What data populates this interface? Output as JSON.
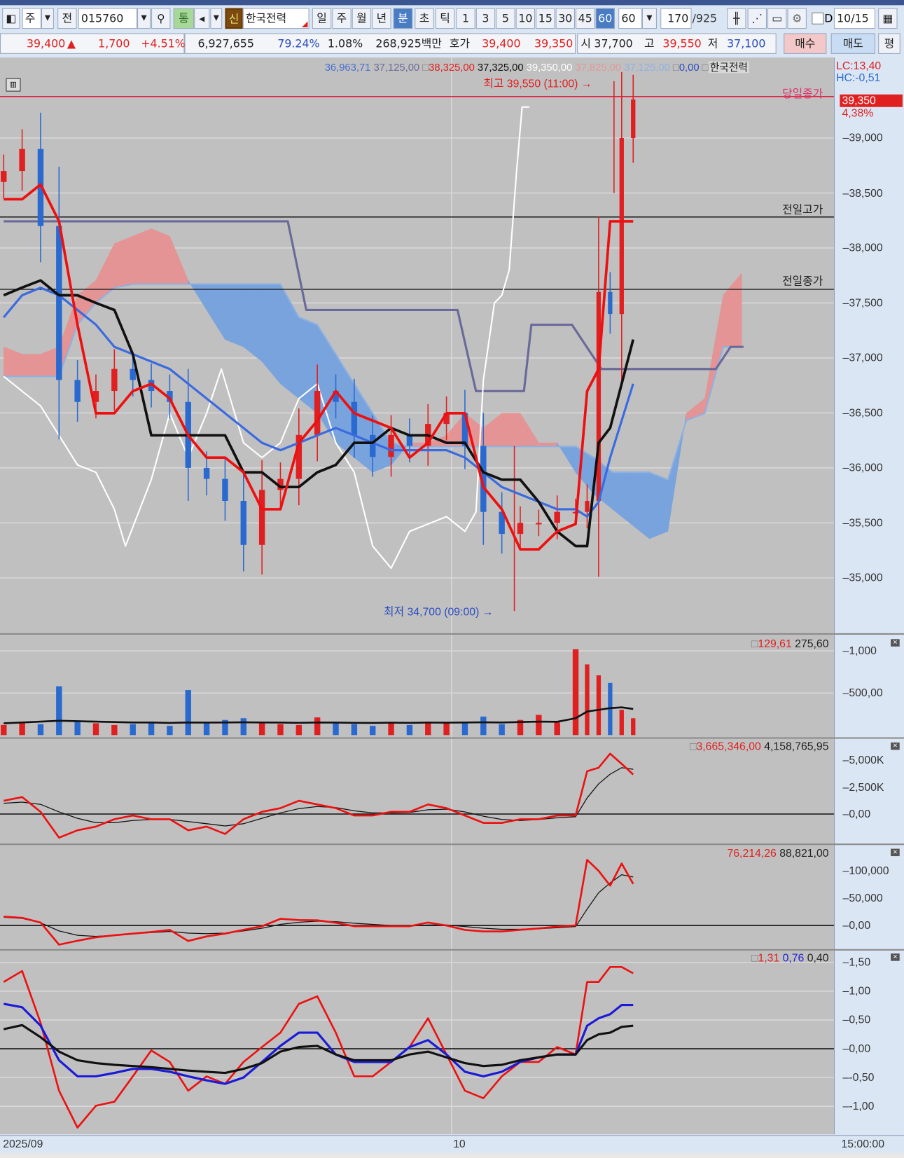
{
  "toolbar": {
    "period_type": "주",
    "prev_label": "전",
    "code": "015760",
    "tong": "통",
    "shin": "신",
    "name": "한국전력",
    "periods": [
      "일",
      "주",
      "월",
      "년",
      "분",
      "초",
      "틱"
    ],
    "minutes": [
      "1",
      "3",
      "5",
      "10",
      "15",
      "30",
      "45",
      "60"
    ],
    "minute_select": "60",
    "count": "170",
    "count_total": "/925",
    "d_label": "D",
    "date": "10/15"
  },
  "quote": {
    "price": "39,400",
    "arrow": "▲",
    "change": "1,700",
    "change_pct": "+4.51%",
    "volume": "6,927,655",
    "ratio": "79.24%",
    "turnover": "1.08%",
    "amount": "268,925백만",
    "bid_label": "호가",
    "ask": "39,400",
    "bid": "39,350",
    "open_label": "시",
    "open": "37,700",
    "high_label": "고",
    "high": "39,550",
    "low_label": "저",
    "low": "37,100",
    "buy": "매수",
    "sell": "매도",
    "avg": "평"
  },
  "main_legend": [
    "36,963,71",
    "37,125,00",
    "38,325,00",
    "37,325,00",
    "39,350,00",
    "37,825,00",
    "37,125,00",
    "0,00",
    "한국전력"
  ],
  "annotations": {
    "high": "최고 39,550 (11:00) →",
    "low": "최저 34,700 (09:00) →",
    "today_close": "당일종가",
    "prev_high": "전일고가",
    "prev_close": "전일종가",
    "lc": "LC:13,40",
    "hc": "HC:-0,51",
    "price_tag": "39,350",
    "pct_tag": "4,38%"
  },
  "colors": {
    "up": "#e02020",
    "down": "#2a6ad0",
    "cloud_up": "#e49494",
    "cloud_down": "#79a3dc",
    "ma": "#3a6ae0",
    "base": "#6a6a9a"
  },
  "chart_data": {
    "type": "candlestick",
    "title": "한국전력 60분",
    "price_axis": {
      "ticks": [
        "39,000",
        "38,500",
        "38,000",
        "37,500",
        "37,000",
        "36,500",
        "36,000",
        "35,500",
        "35,000"
      ],
      "tick_values": [
        39000,
        38500,
        38000,
        37500,
        37000,
        36500,
        36000,
        35500,
        35000
      ]
    },
    "x_labels": [
      "2025/09",
      "10",
      "15:00:00"
    ],
    "first_open": 38600,
    "closes": [
      38700,
      38900,
      38200,
      36800,
      36600,
      36700,
      36900,
      36800,
      36700,
      36600,
      36000,
      35900,
      35700,
      35300,
      35800,
      35900,
      36300,
      36700,
      36600,
      36300,
      36100,
      36300,
      36200,
      36400,
      36500,
      36200,
      35600,
      35400,
      35500,
      35500,
      35600,
      35600,
      35700,
      37600,
      37400,
      39000,
      39350
    ],
    "lines": {
      "conversion": [
        38443,
        38443,
        38577,
        38242,
        37302,
        36497,
        36497,
        36698,
        36765,
        36631,
        36296,
        36094,
        36094,
        35960,
        35624,
        35624,
        36228,
        36430,
        36698,
        36497,
        36430,
        36363,
        36094,
        36228,
        36497,
        36497,
        35826,
        35624,
        35260,
        35260,
        35423,
        35490,
        36698,
        36899,
        38242,
        38242,
        38242
      ],
      "base": [
        37570,
        37640,
        37705,
        37570,
        37570,
        37500,
        37436,
        37034,
        36296,
        36296,
        36296,
        36296,
        36296,
        35960,
        35960,
        35826,
        35826,
        35960,
        36027,
        36228,
        36228,
        36363,
        36296,
        36296,
        36228,
        36228,
        35960,
        35893,
        35893,
        35691,
        35423,
        35289,
        35289,
        36228,
        36363,
        36765,
        37168
      ],
      "ma": [
        37369,
        37570,
        37638,
        37570,
        37436,
        37302,
        37101,
        37034,
        36967,
        36899,
        36765,
        36631,
        36497,
        36363,
        36228,
        36161,
        36228,
        36296,
        36363,
        36296,
        36228,
        36161,
        36161,
        36161,
        36161,
        36094,
        35960,
        35826,
        35759,
        35691,
        35624,
        35624,
        35557,
        35691,
        36094,
        36430,
        36765
      ],
      "lagging": [
        [
          0,
          36832
        ],
        [
          2,
          36564
        ],
        [
          4,
          36027
        ],
        [
          5,
          35960
        ],
        [
          6,
          35624
        ],
        [
          6.6,
          35289
        ],
        [
          8,
          35893
        ],
        [
          9,
          36497
        ],
        [
          10,
          36094
        ],
        [
          11,
          36497
        ],
        [
          11.8,
          36899
        ],
        [
          13,
          36228
        ],
        [
          14,
          36094
        ],
        [
          15,
          36228
        ],
        [
          16,
          36631
        ],
        [
          17,
          36765
        ],
        [
          18,
          36228
        ],
        [
          19,
          35960
        ],
        [
          20,
          35289
        ],
        [
          21,
          35088
        ],
        [
          22,
          35423
        ],
        [
          23,
          35490
        ],
        [
          24,
          35557
        ],
        [
          25,
          35423
        ],
        [
          25.6,
          35600
        ],
        [
          26,
          36800
        ],
        [
          26.6,
          37500
        ],
        [
          27,
          37570
        ],
        [
          27.4,
          37800
        ],
        [
          27.8,
          38700
        ],
        [
          28.1,
          39282
        ],
        [
          28.5,
          39282
        ]
      ],
      "long_base": [
        [
          0,
          38242
        ],
        [
          15.4,
          38242
        ],
        [
          16.4,
          37436
        ],
        [
          24.6,
          37436
        ],
        [
          25.6,
          36698
        ],
        [
          28.2,
          36698
        ],
        [
          28.6,
          37302
        ],
        [
          30.8,
          37302
        ],
        [
          32.4,
          36899
        ],
        [
          38.6,
          36899
        ],
        [
          39.4,
          37101
        ],
        [
          40.1,
          37101
        ]
      ],
      "span_a": [
        37101,
        37034,
        37034,
        37101,
        37570,
        37705,
        38040,
        38107,
        38175,
        38107,
        37705,
        37436,
        37168,
        37101,
        36967,
        36765,
        36631,
        36497,
        36228,
        36094,
        35960,
        36027,
        36228,
        36228,
        36296,
        36497,
        36363,
        36497,
        36497,
        36228,
        36228,
        35960,
        35759,
        35624,
        35490,
        35356,
        35423,
        36497,
        36631,
        37570,
        37772
      ],
      "span_b": [
        36832,
        36832,
        36832,
        36832,
        37302,
        37503,
        37638,
        37671,
        37671,
        37671,
        37671,
        37671,
        37671,
        37671,
        37671,
        37671,
        37369,
        37302,
        37034,
        36765,
        36497,
        36228,
        36195,
        36195,
        36195,
        36195,
        36195,
        36195,
        36195,
        36195,
        36195,
        36195,
        36094,
        35960,
        35960,
        35960,
        35893,
        36430,
        36497,
        37101,
        37101
      ]
    },
    "volume": {
      "legend": [
        "129,61",
        "275,60"
      ],
      "ticks": [
        "1,000",
        "500,00"
      ],
      "values": [
        120,
        150,
        130,
        580,
        160,
        140,
        120,
        130,
        150,
        110,
        535,
        140,
        180,
        200,
        150,
        130,
        120,
        210,
        150,
        130,
        110,
        140,
        120,
        160,
        140,
        150,
        220,
        130,
        180,
        240,
        150,
        1020,
        840,
        710,
        620,
        300,
        200
      ],
      "ma": [
        140,
        150,
        160,
        170,
        165,
        160,
        155,
        150,
        150,
        145,
        150,
        148,
        150,
        152,
        150,
        148,
        146,
        150,
        148,
        146,
        145,
        147,
        146,
        148,
        147,
        150,
        152,
        150,
        155,
        160,
        158,
        200,
        280,
        300,
        320,
        330,
        310
      ]
    },
    "obv": {
      "legend": [
        "3,665,346,00",
        "4,158,765,95"
      ],
      "ticks": [
        "5,000K",
        "2,500K",
        "0,00"
      ],
      "unit": "K",
      "red": [
        1233,
        1576,
        206,
        -2192,
        -1507,
        -1165,
        -480,
        -137,
        -480,
        -480,
        -1507,
        -1165,
        -1850,
        -480,
        206,
        548,
        1233,
        891,
        548,
        -137,
        -137,
        206,
        206,
        891,
        548,
        -137,
        -822,
        -822,
        -480,
        -480,
        -137,
        -137,
        3973,
        4300,
        5600,
        4658,
        3665
      ],
      "black": [
        1000,
        1100,
        900,
        200,
        -400,
        -800,
        -800,
        -600,
        -500,
        -500,
        -700,
        -900,
        -1100,
        -900,
        -400,
        100,
        500,
        700,
        600,
        300,
        100,
        100,
        150,
        400,
        450,
        200,
        -200,
        -500,
        -600,
        -500,
        -350,
        -250,
        1500,
        2800,
        3700,
        4300,
        4159
      ]
    },
    "ind2": {
      "legend": [
        "76,214,26",
        "88,821,00"
      ],
      "ticks": [
        "100,000",
        "50,000",
        "0,00"
      ],
      "red": [
        16200,
        14000,
        5400,
        -35100,
        -28000,
        -21600,
        -18000,
        -14900,
        -12000,
        -8100,
        -28400,
        -20000,
        -14900,
        -8000,
        -1400,
        12200,
        10000,
        9500,
        5000,
        -1400,
        -1400,
        -1400,
        -1400,
        5400,
        0,
        -8100,
        -10800,
        -10800,
        -8000,
        -5400,
        -2000,
        0,
        120200,
        100000,
        73000,
        113500,
        76214
      ],
      "black": [
        15000,
        13000,
        5000,
        -10000,
        -18000,
        -20000,
        -18000,
        -15000,
        -13000,
        -11000,
        -14000,
        -15000,
        -14000,
        -10000,
        -5000,
        2000,
        6000,
        8000,
        7000,
        4000,
        2000,
        0,
        -1000,
        1000,
        1000,
        -2000,
        -5000,
        -7000,
        -7000,
        -6000,
        -4000,
        -2000,
        30000,
        60000,
        78000,
        93000,
        88821
      ]
    },
    "ind3": {
      "legend": [
        "1,31",
        "0,76",
        "0,40"
      ],
      "ticks": [
        "1,50",
        "1,00",
        "0,50",
        "0,00",
        "-0,50",
        "-1,00"
      ],
      "tick_values": [
        1.5,
        1,
        0.5,
        0,
        -0.5,
        -1
      ],
      "red": [
        1.16,
        1.35,
        0.45,
        -0.73,
        -1.37,
        -0.99,
        -0.92,
        -0.48,
        -0.03,
        -0.23,
        -0.73,
        -0.48,
        -0.61,
        -0.23,
        0.03,
        0.28,
        0.78,
        0.91,
        0.28,
        -0.48,
        -0.48,
        -0.23,
        0.03,
        0.53,
        -0.1,
        -0.73,
        -0.86,
        -0.48,
        -0.23,
        -0.23,
        0.03,
        -0.1,
        1.16,
        1.16,
        1.42,
        1.42,
        1.31
      ],
      "blue": [
        0.78,
        0.72,
        0.4,
        -0.2,
        -0.48,
        -0.48,
        -0.42,
        -0.35,
        -0.35,
        -0.4,
        -0.48,
        -0.55,
        -0.61,
        -0.5,
        -0.23,
        0.05,
        0.28,
        0.28,
        -0.1,
        -0.23,
        -0.23,
        -0.23,
        0.03,
        0.15,
        -0.1,
        -0.4,
        -0.48,
        -0.4,
        -0.23,
        -0.15,
        -0.1,
        -0.1,
        0.4,
        0.53,
        0.6,
        0.76,
        0.76
      ],
      "black": [
        0.34,
        0.41,
        0.2,
        -0.05,
        -0.2,
        -0.25,
        -0.28,
        -0.3,
        -0.32,
        -0.35,
        -0.38,
        -0.4,
        -0.42,
        -0.35,
        -0.25,
        -0.05,
        0.03,
        0.05,
        -0.1,
        -0.2,
        -0.2,
        -0.2,
        -0.1,
        -0.05,
        -0.15,
        -0.25,
        -0.3,
        -0.28,
        -0.2,
        -0.15,
        -0.1,
        -0.1,
        0.15,
        0.25,
        0.28,
        0.38,
        0.4
      ]
    }
  }
}
